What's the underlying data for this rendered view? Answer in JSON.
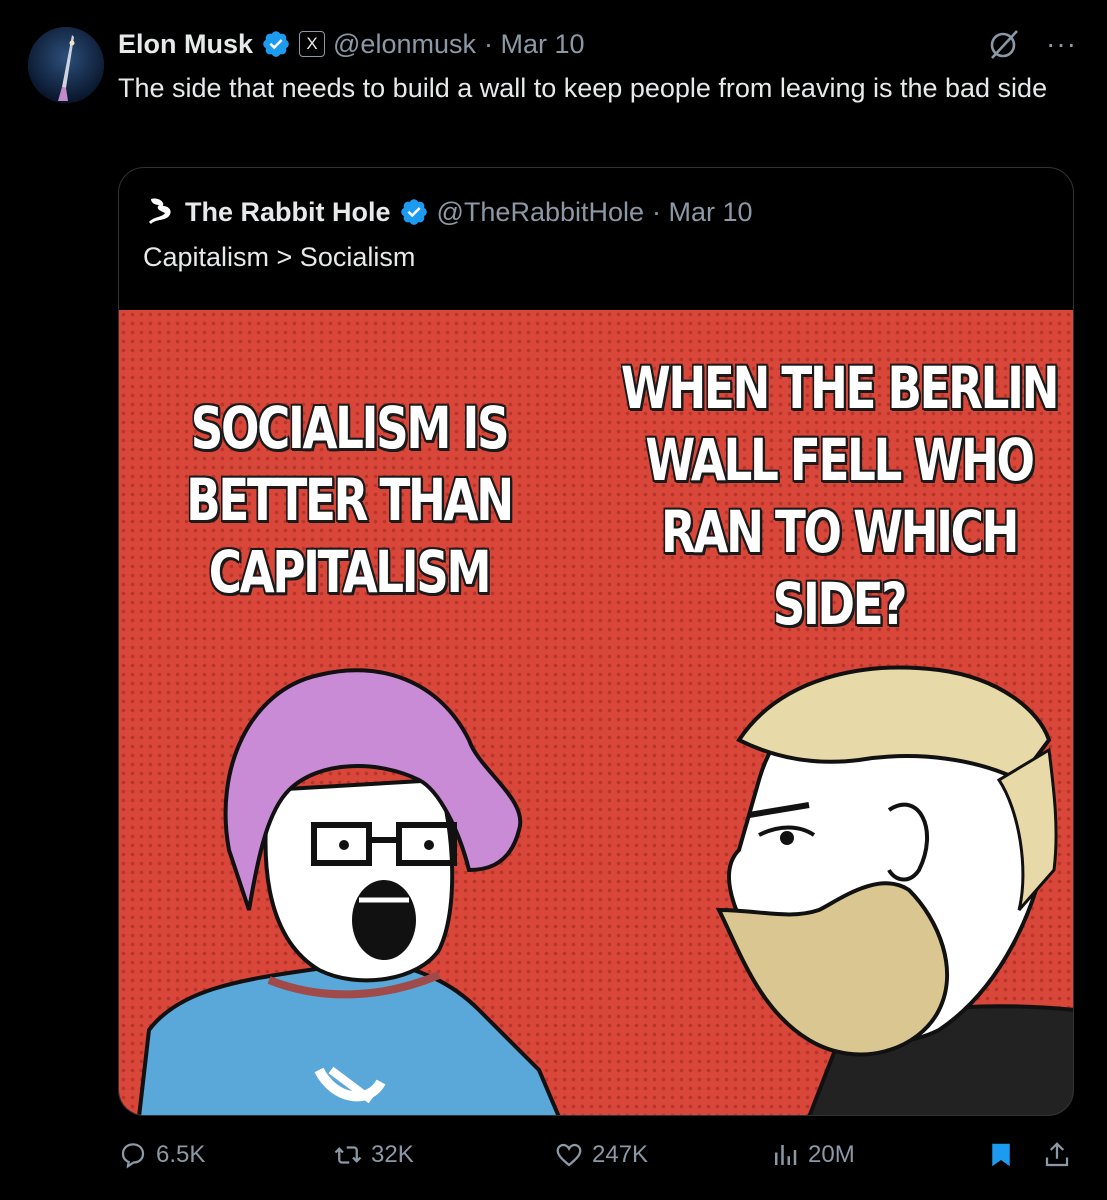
{
  "tweet": {
    "author_name": "Elon Musk",
    "handle": "@elonmusk",
    "date": "· Mar 10",
    "text": "The side that needs to build a wall to keep people from leaving is the bad side",
    "affiliate_badge": "X"
  },
  "quote": {
    "author_name": "The Rabbit Hole",
    "handle": "@TheRabbitHole",
    "date": "· Mar 10",
    "text": "Capitalism > Socialism",
    "meme_left": "SOCIALISM IS BETTER THAN CAPITALISM",
    "meme_right": "WHEN THE BERLIN WALL FELL WHO RAN TO WHICH SIDE?"
  },
  "actions": {
    "replies": "6.5K",
    "retweets": "32K",
    "likes": "247K",
    "views": "20M"
  },
  "colors": {
    "background": "#000000",
    "text": "#e7e9ea",
    "muted": "#8b98a5",
    "verified": "#1d9bf0",
    "meme_red": "#d9463a"
  },
  "icons": {
    "verified": "verified-badge-icon",
    "grok": "grok-icon",
    "more": "more-icon",
    "reply": "reply-icon",
    "retweet": "retweet-icon",
    "like": "heart-icon",
    "views": "views-icon",
    "bookmark": "bookmark-icon",
    "share": "share-icon"
  }
}
